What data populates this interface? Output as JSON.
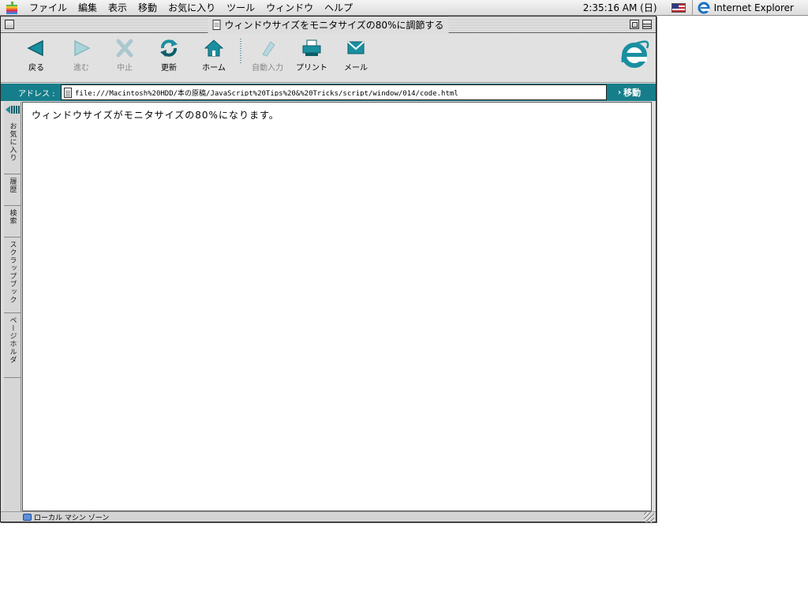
{
  "menubar": {
    "items": [
      "ファイル",
      "編集",
      "表示",
      "移動",
      "お気に入り",
      "ツール",
      "ウィンドウ",
      "ヘルプ"
    ],
    "clock": "2:35:16 AM (日)",
    "app_name": "Internet Explorer"
  },
  "window": {
    "title": "ウィンドウサイズをモニタサイズの80%に調節する"
  },
  "toolbar": {
    "back": "戻る",
    "forward": "進む",
    "stop": "中止",
    "refresh": "更新",
    "home": "ホーム",
    "autofill": "自動入力",
    "print": "プリント",
    "mail": "メール"
  },
  "address": {
    "label": "アドレス :",
    "url": "file:///Macintosh%20HDD/本の原稿/JavaScript%20Tips%20&%20Tricks/script/window/014/code.html",
    "go": "移動"
  },
  "sidebar": {
    "favorites": "お気に入り",
    "history": "履歴",
    "search": "検索",
    "scrapbook": "スクラップブック",
    "page_holder": "ページホルダ"
  },
  "content": {
    "text": "ウィンドウサイズがモニタサイズの80%になります。"
  },
  "status": {
    "zone": "ローカル マシン ゾーン"
  },
  "colors": {
    "accent": "#167e8a",
    "icon_teal": "#1a8fa0"
  }
}
